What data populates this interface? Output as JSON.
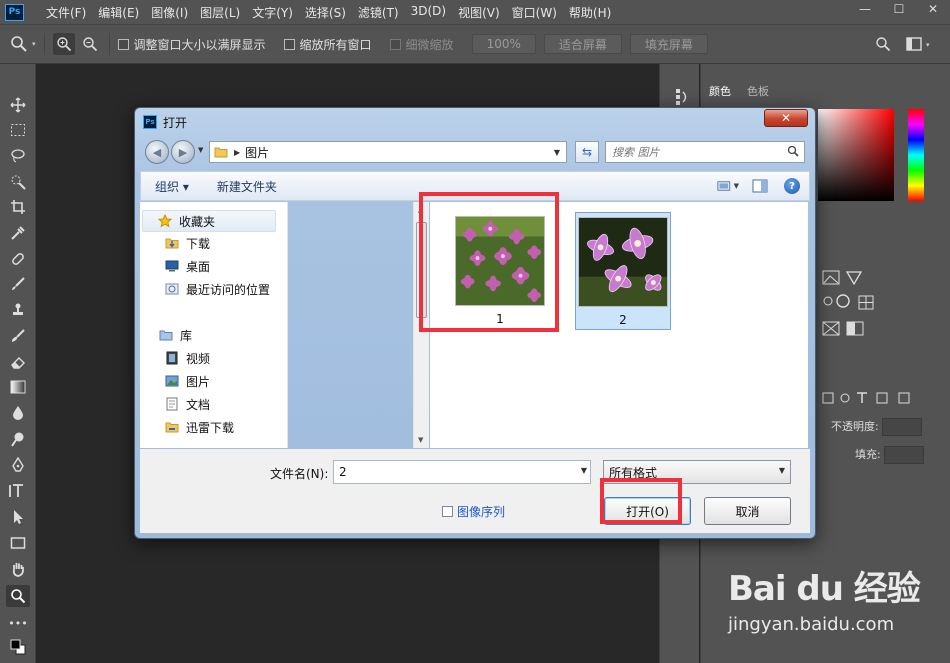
{
  "app": {
    "logo": "Ps",
    "menu": [
      "文件(F)",
      "编辑(E)",
      "图像(I)",
      "图层(L)",
      "文字(Y)",
      "选择(S)",
      "滤镜(T)",
      "3D(D)",
      "视图(V)",
      "窗口(W)",
      "帮助(H)"
    ],
    "window_buttons": {
      "minimize": "—",
      "maximize": "☐",
      "close": "✕"
    }
  },
  "options_bar": {
    "resize_window": "调整窗口大小以满屏显示",
    "zoom_all": "缩放所有窗口",
    "scrubby_zoom": "细微缩放",
    "zoom_percent": "100%",
    "fit_screen": "适合屏幕",
    "fill_screen": "填充屏幕"
  },
  "right_panel": {
    "tabs": [
      "颜色",
      "色板"
    ],
    "opacity_label": "不透明度:",
    "fill_label": "填充:"
  },
  "dialog": {
    "title": "打开",
    "close": "✕",
    "address": "图片",
    "search_placeholder": "搜索 图片",
    "organize": "组织 ▾",
    "new_folder": "新建文件夹",
    "help": "?",
    "tree": {
      "favorites_header": "收藏夹",
      "favorites": [
        "下载",
        "桌面",
        "最近访问的位置"
      ],
      "libraries_header": "库",
      "libraries": [
        "视频",
        "图片",
        "文档",
        "迅雷下载"
      ]
    },
    "files": [
      {
        "label": "1",
        "selected": false
      },
      {
        "label": "2",
        "selected": true
      }
    ],
    "filename_label": "文件名(N):",
    "filename_value": "2",
    "format": "所有格式",
    "image_sequence": "图像序列",
    "open_button": "打开(O)",
    "cancel_button": "取消"
  },
  "watermark": {
    "logo": "Bai du 经验",
    "url": "jingyan.baidu.com"
  },
  "colors": {
    "ps_panel": "#535353",
    "canvas": "#282828",
    "highlight": "#f0303a",
    "selection": "#cce4fb"
  }
}
